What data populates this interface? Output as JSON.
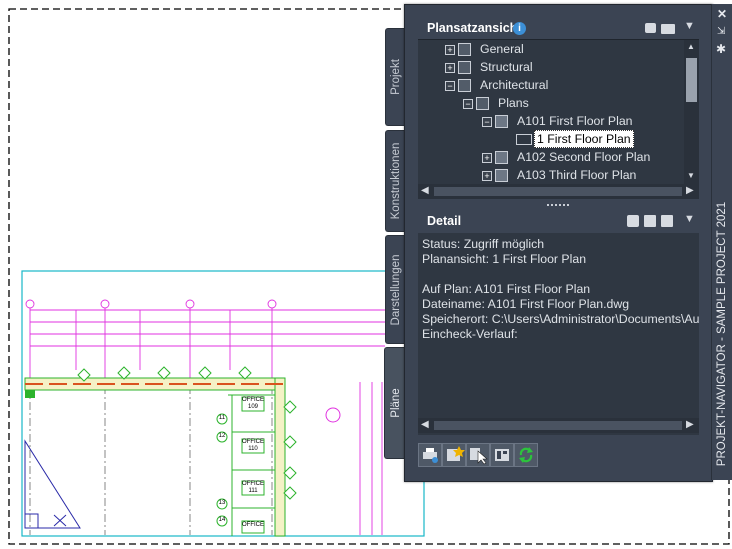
{
  "left_tabs": [
    {
      "label": "Projekt"
    },
    {
      "label": "Konstruktionen"
    },
    {
      "label": "Darstellungen"
    },
    {
      "label": "Pläne"
    }
  ],
  "sheet_set": {
    "title": "Plansatzansicht",
    "tree": [
      {
        "label": "General"
      },
      {
        "label": "Structural"
      },
      {
        "label": "Architectural"
      },
      {
        "label": "Plans"
      },
      {
        "label": "A101 First Floor Plan"
      },
      {
        "label": "1 First Floor Plan"
      },
      {
        "label": "A102 Second Floor Plan"
      },
      {
        "label": "A103 Third Floor Plan"
      }
    ]
  },
  "detail": {
    "title": "Detail",
    "status": "Status: Zugriff möglich",
    "plan_view": "Planansicht: 1 First Floor Plan",
    "on_plan": "Auf Plan: A101 First Floor Plan",
    "file_name": "Dateiname: A101 First Floor Plan.dwg",
    "location": "Speicherort: C:\\Users\\Administrator\\Documents\\Aut",
    "checkin": "Eincheck-Verlauf:"
  },
  "side_title": "PROJEKT-NAVIGATOR - SAMPLE PROJECT 2021",
  "drawing": {
    "rooms": [
      {
        "label": "OFFICE",
        "number": "109"
      },
      {
        "label": "OFFICE",
        "number": "110"
      },
      {
        "label": "OFFICE",
        "number": "111"
      },
      {
        "label": "OFFICE",
        "number": ""
      }
    ],
    "bubbles": [
      "11",
      "12",
      "13",
      "14"
    ]
  },
  "colors": {
    "accent": "#3c8fd6",
    "panel": "#3b4453",
    "magenta": "#e032e0",
    "green": "#2cb32c",
    "cyan": "#1fb5c6"
  }
}
